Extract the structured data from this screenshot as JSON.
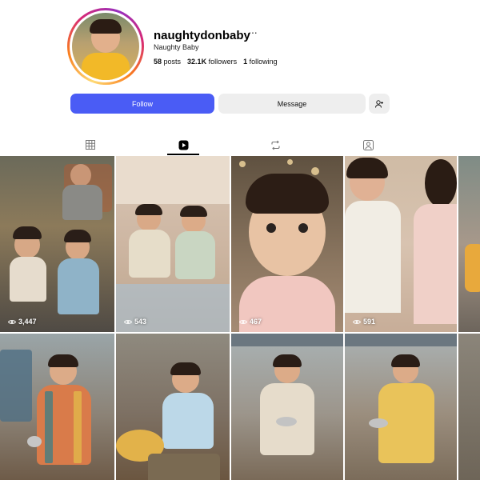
{
  "profile": {
    "username": "naughtydonbaby",
    "more_icon": "···",
    "full_name": "Naughty Baby",
    "posts_count": "58",
    "posts_label": "posts",
    "followers_count": "32.1K",
    "followers_label": "followers",
    "following_count": "1",
    "following_label": "following"
  },
  "actions": {
    "follow_label": "Follow",
    "message_label": "Message",
    "follow_color": "#4a5cf5"
  },
  "tabs": [
    {
      "name": "grid",
      "icon": "grid-icon",
      "active": false
    },
    {
      "name": "reels",
      "icon": "reels-icon",
      "active": true
    },
    {
      "name": "reposts",
      "icon": "repost-icon",
      "active": false
    },
    {
      "name": "tagged",
      "icon": "tagged-icon",
      "active": false
    }
  ],
  "posts": [
    {
      "scene": "toddlers at street food stall",
      "views": "3,447"
    },
    {
      "scene": "toddlers sitting on bed with toys",
      "views": "543"
    },
    {
      "scene": "baby girl close-up portrait",
      "views": "467"
    },
    {
      "scene": "girl tying rakhi on boy",
      "views": "591"
    },
    {
      "scene": "railway platform",
      "views": ""
    },
    {
      "scene": "toddler with bowl on railway platform",
      "views": ""
    },
    {
      "scene": "toddler at food stall with snacks",
      "views": ""
    },
    {
      "scene": "toddler in kurta holding bowl at station",
      "views": ""
    },
    {
      "scene": "toddler in yellow kurta on platform",
      "views": ""
    },
    {
      "scene": "railway platform partial",
      "views": ""
    }
  ]
}
